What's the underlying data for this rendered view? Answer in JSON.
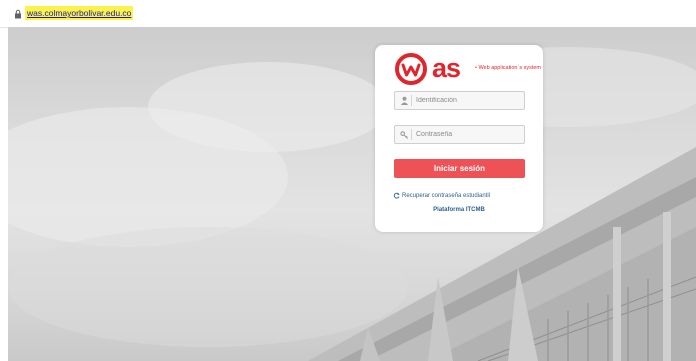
{
  "address_bar": {
    "url": "was.colmayorbolivar.edu.co"
  },
  "login": {
    "brand": "as",
    "tagline": "• Web application´s system",
    "id_field": {
      "placeholder": "Identificación",
      "value": ""
    },
    "password_field": {
      "placeholder": "Contraseña",
      "value": ""
    },
    "submit_label": "Iniciar sesión",
    "recover_label": "Recuperar contraseña estudiantil",
    "platform_label": "Plataforma ITCMB"
  },
  "colors": {
    "brand_red": "#e0262c",
    "button": "#ee5256",
    "url_highlight": "#fbf24a"
  },
  "icons": [
    "lock-icon",
    "user-icon",
    "key-icon",
    "refresh-icon"
  ]
}
